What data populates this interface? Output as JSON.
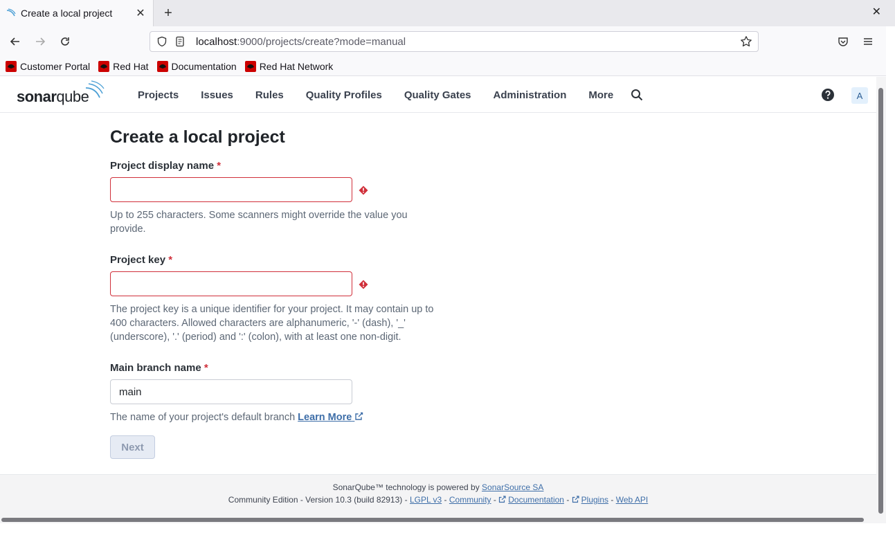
{
  "browser": {
    "tab_title": "Create a local project",
    "url_host": "localhost",
    "url_rest": ":9000/projects/create?mode=manual",
    "bookmarks": [
      "Customer Portal",
      "Red Hat",
      "Documentation",
      "Red Hat Network"
    ]
  },
  "header": {
    "logo_sonar": "sonar",
    "logo_qube": "qube",
    "nav": [
      "Projects",
      "Issues",
      "Rules",
      "Quality Profiles",
      "Quality Gates",
      "Administration",
      "More"
    ],
    "avatar": "A"
  },
  "form": {
    "title": "Create a local project",
    "display_name_label": "Project display name",
    "display_name_value": "",
    "display_name_help": "Up to 255 characters. Some scanners might override the value you provide.",
    "project_key_label": "Project key",
    "project_key_value": "",
    "project_key_help": "The project key is a unique identifier for your project. It may contain up to 400 characters. Allowed characters are alphanumeric, '-' (dash), '_' (underscore), '.' (period) and ':' (colon), with at least one non-digit.",
    "main_branch_label": "Main branch name",
    "main_branch_value": "main",
    "main_branch_help": "The name of your project's default branch",
    "learn_more": "Learn More",
    "required_marker": "*",
    "next_button": "Next"
  },
  "footer": {
    "powered_prefix": "SonarQube™ technology is powered by",
    "powered_link": "SonarSource SA",
    "edition": "Community Edition - Version 10.3 (build 82913) -",
    "lgpl": "LGPL v3",
    "community": "Community",
    "documentation": "Documentation",
    "plugins": "Plugins",
    "webapi": "Web API",
    "sep": "-"
  },
  "colors": {
    "error": "#d02f3a",
    "link": "#3e6ea8",
    "avatar_bg": "#e3f0fc"
  }
}
